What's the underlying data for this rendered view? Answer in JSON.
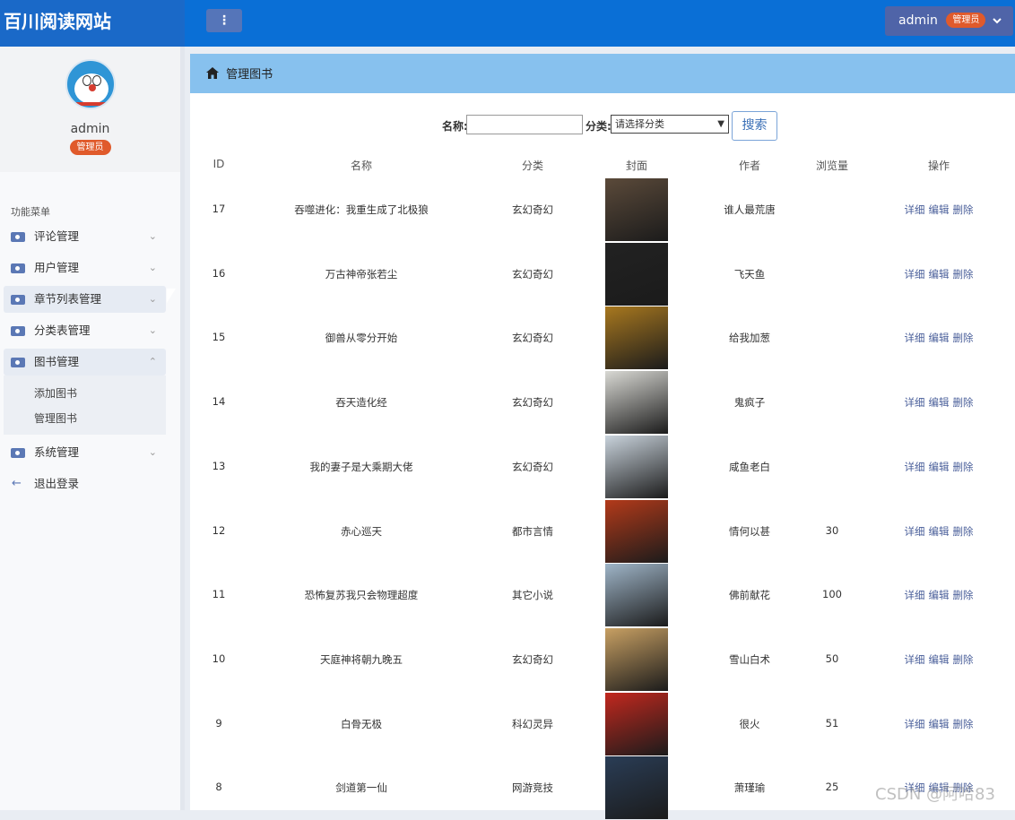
{
  "header": {
    "site_title": "百川阅读网站",
    "menu_toggle_glyph": "⋮",
    "user_name": "admin",
    "user_role": "管理员"
  },
  "profile": {
    "name": "admin",
    "role": "管理员"
  },
  "sidebar": {
    "section_title": "功能菜单",
    "items": [
      {
        "label": "评论管理"
      },
      {
        "label": "用户管理"
      },
      {
        "label": "章节列表管理"
      },
      {
        "label": "分类表管理"
      },
      {
        "label": "图书管理"
      }
    ],
    "subitems": [
      {
        "label": "添加图书"
      },
      {
        "label": "管理图书"
      }
    ],
    "system": {
      "label": "系统管理"
    },
    "logout": {
      "label": "退出登录"
    }
  },
  "breadcrumb": {
    "title": "管理图书"
  },
  "search": {
    "name_label": "名称:",
    "name_value": "",
    "category_label": "分类:",
    "category_selected": "请选择分类",
    "button_label": "搜索"
  },
  "table": {
    "headers": [
      "ID",
      "名称",
      "分类",
      "封面",
      "作者",
      "浏览量",
      "操作"
    ],
    "ops": [
      "详细",
      "编辑",
      "删除"
    ],
    "rows": [
      {
        "id": "17",
        "name": "吞噬进化：我重生成了北极狼",
        "category": "玄幻奇幻",
        "author": "谁人最荒唐",
        "views": "",
        "cover_color": "#5b4a3a"
      },
      {
        "id": "16",
        "name": "万古神帝张若尘",
        "category": "玄幻奇幻",
        "author": "飞天鱼",
        "views": "",
        "cover_color": "#222222"
      },
      {
        "id": "15",
        "name": "御兽从零分开始",
        "category": "玄幻奇幻",
        "author": "给我加葱",
        "views": "",
        "cover_color": "#a8781f"
      },
      {
        "id": "14",
        "name": "吞天造化经",
        "category": "玄幻奇幻",
        "author": "鬼疯子",
        "views": "",
        "cover_color": "#d9d9d4"
      },
      {
        "id": "13",
        "name": "我的妻子是大乘期大佬",
        "category": "玄幻奇幻",
        "author": "咸鱼老白",
        "views": "",
        "cover_color": "#c9d3dc"
      },
      {
        "id": "12",
        "name": "赤心巡天",
        "category": "都市言情",
        "author": "情何以甚",
        "views": "30",
        "cover_color": "#b33a1a"
      },
      {
        "id": "11",
        "name": "恐怖复苏我只会物理超度",
        "category": "其它小说",
        "author": "佛前献花",
        "views": "100",
        "cover_color": "#9fb5c8"
      },
      {
        "id": "10",
        "name": "天庭神将朝九晚五",
        "category": "玄幻奇幻",
        "author": "雪山白术",
        "views": "50",
        "cover_color": "#c8a063"
      },
      {
        "id": "9",
        "name": "白骨无极",
        "category": "科幻灵异",
        "author": "很火",
        "views": "51",
        "cover_color": "#c2281e"
      },
      {
        "id": "8",
        "name": "剑道第一仙",
        "category": "网游竞技",
        "author": "萧瑾瑜",
        "views": "25",
        "cover_color": "#2a3d56"
      }
    ]
  },
  "watermark": "CSDN @阿哈83"
}
